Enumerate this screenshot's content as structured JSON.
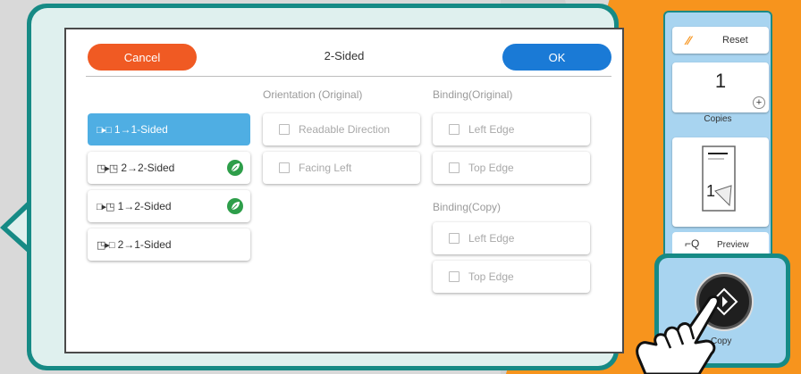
{
  "dialog": {
    "title": "2-Sided",
    "cancel_label": "Cancel",
    "ok_label": "OK"
  },
  "modes": [
    {
      "label": "1→1-Sided",
      "selected": true,
      "eco": false
    },
    {
      "label": "2→2-Sided",
      "selected": false,
      "eco": true
    },
    {
      "label": "1→2-Sided",
      "selected": false,
      "eco": true
    },
    {
      "label": "2→1-Sided",
      "selected": false,
      "eco": false
    }
  ],
  "orientation": {
    "header": "Orientation (Original)",
    "options": [
      "Readable Direction",
      "Facing Left"
    ]
  },
  "binding_original": {
    "header": "Binding(Original)",
    "options": [
      "Left Edge",
      "Top Edge"
    ]
  },
  "binding_copy": {
    "header": "Binding(Copy)",
    "options": [
      "Left Edge",
      "Top Edge"
    ]
  },
  "side_panel": {
    "reset_label": "Reset",
    "copies_value": "1",
    "copies_label": "Copies",
    "preview_label": "Preview",
    "copy_label": "Copy"
  },
  "colors": {
    "cancel": "#f05a23",
    "ok": "#1a7ad6",
    "selected": "#4faee3",
    "frame": "#168a85",
    "eco_leaf": "#2e9e4a"
  },
  "icons": [
    "eco-leaf-icon",
    "reset-icon",
    "plus-icon",
    "preview-icon",
    "start-copy-icon",
    "pointing-hand-icon"
  ]
}
